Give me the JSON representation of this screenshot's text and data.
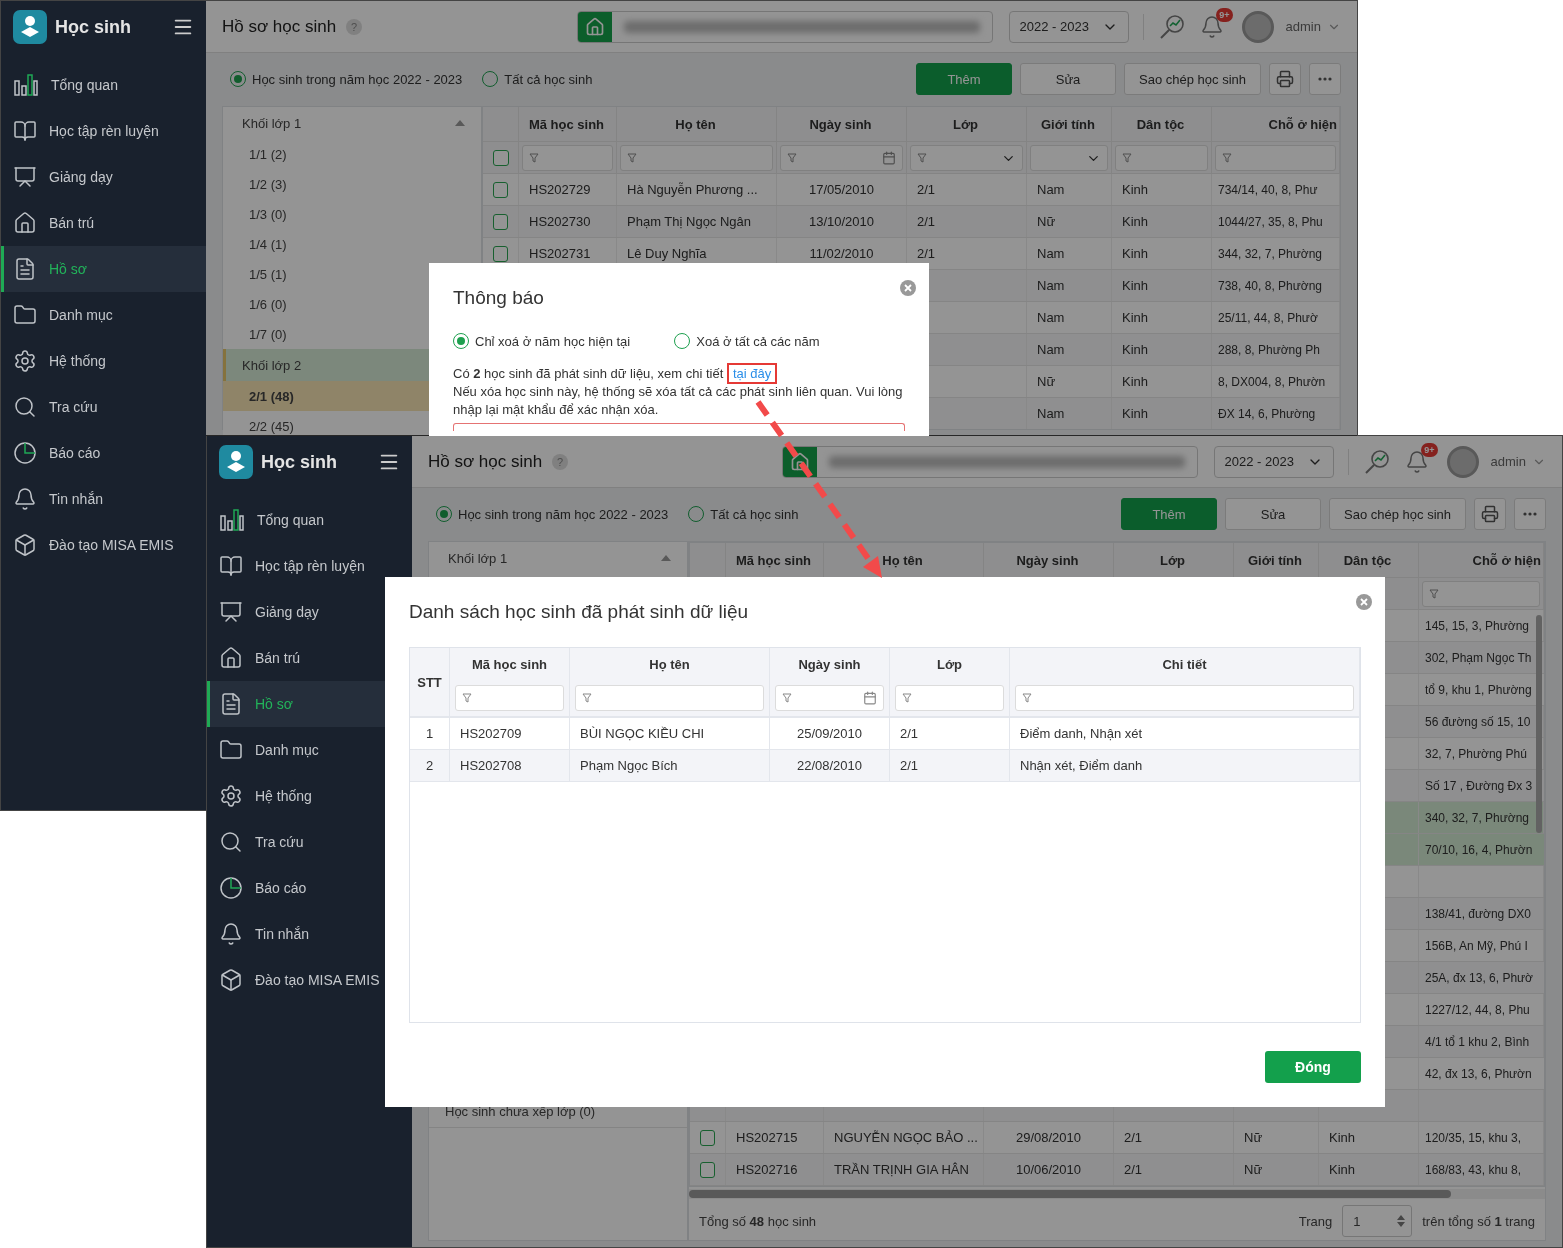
{
  "back_window": {
    "sidebar": {
      "app_title": "Học sinh",
      "items": [
        {
          "label": "Tổng quan",
          "selected": false
        },
        {
          "label": "Học tập rèn luyện",
          "selected": false
        },
        {
          "label": "Giảng dạy",
          "selected": false
        },
        {
          "label": "Bán trú",
          "selected": false
        },
        {
          "label": "Hồ sơ",
          "selected": true
        },
        {
          "label": "Danh mục",
          "selected": false
        },
        {
          "label": "Hệ thống",
          "selected": false
        },
        {
          "label": "Tra cứu",
          "selected": false
        },
        {
          "label": "Báo cáo",
          "selected": false
        },
        {
          "label": "Tin nhắn",
          "selected": false
        },
        {
          "label": "Đào tạo MISA EMIS",
          "selected": false
        }
      ]
    },
    "header": {
      "title": "Hồ sơ học sinh",
      "help": "?",
      "year": "2022 - 2023",
      "badge": "9+",
      "user": "admin"
    },
    "toolbar": {
      "filters": [
        {
          "label": "Học sinh trong năm học 2022 - 2023",
          "selected": true
        },
        {
          "label": "Tất cả học sinh",
          "selected": false
        }
      ],
      "buttons": [
        {
          "kind": "primary",
          "label": "Thêm"
        },
        {
          "kind": "secondary",
          "label": "Sửa"
        },
        {
          "kind": "secondary",
          "label": "Sao chép học sinh"
        },
        {
          "kind": "print"
        },
        {
          "kind": "more"
        }
      ]
    },
    "tree": {
      "groups": [
        {
          "label": "Khối lớp 1",
          "expanded": true,
          "selected": false,
          "children": [
            {
              "label": "1/1 (2)",
              "selected": false
            },
            {
              "label": "1/2 (3)",
              "selected": false
            },
            {
              "label": "1/3 (0)",
              "selected": false
            },
            {
              "label": "1/4 (1)",
              "selected": false
            },
            {
              "label": "1/5 (1)",
              "selected": false
            },
            {
              "label": "1/6 (0)",
              "selected": false
            },
            {
              "label": "1/7 (0)",
              "selected": false
            }
          ]
        },
        {
          "label": "Khối lớp 2",
          "selected": true,
          "children": [
            {
              "label": "2/1 (48)",
              "selected": true
            },
            {
              "label": "2/2 (45)",
              "selected": false
            }
          ]
        }
      ]
    },
    "table": {
      "header_checkbox": false,
      "columns": [
        {
          "label": "Mã học sinh",
          "kind": "text"
        },
        {
          "label": "Họ tên",
          "kind": "text"
        },
        {
          "label": "Ngày sinh",
          "kind": "date"
        },
        {
          "label": "Lớp",
          "kind": "select"
        },
        {
          "label": "Giới tính",
          "kind": "dropdown"
        },
        {
          "label": "Dân tộc",
          "kind": "text"
        },
        {
          "label": "Chỗ ở hiện",
          "kind": "text"
        }
      ],
      "rows": [
        {
          "selected": false,
          "code": "HS202729",
          "name": "Hà Nguyễn Phương ...",
          "dob": "17/05/2010",
          "class": "2/1",
          "gender": "Nam",
          "ethnicity": "Kinh",
          "address": "734/14, 40, 8, Phư"
        },
        {
          "selected": false,
          "code": "HS202730",
          "name": "Phạm Thị Ngọc Ngân",
          "dob": "13/10/2010",
          "class": "2/1",
          "gender": "Nữ",
          "ethnicity": "Kinh",
          "address": "1044/27, 35, 8, Phu"
        },
        {
          "selected": false,
          "code": "HS202731",
          "name": "Lê Duy Nghĩa",
          "dob": "11/02/2010",
          "class": "2/1",
          "gender": "Nam",
          "ethnicity": "Kinh",
          "address": "344, 32, 7, Phường"
        },
        {
          "selected": false,
          "gender": "Nam",
          "ethnicity": "Kinh",
          "address": "738, 40, 8, Phường"
        },
        {
          "selected": false,
          "gender": "Nam",
          "ethnicity": "Kinh",
          "address": "25/11, 44, 8, Phườ"
        },
        {
          "selected": false,
          "gender": "Nam",
          "ethnicity": "Kinh",
          "address": "288, 8, Phường Ph"
        },
        {
          "selected": false,
          "gender": "Nữ",
          "ethnicity": "Kinh",
          "address": "8, DX004, 8, Phườn"
        },
        {
          "selected": false,
          "gender": "Nam",
          "ethnicity": "Kinh",
          "address": "ĐX 14, 6, Phường"
        }
      ]
    },
    "modal": {
      "title": "Thông báo",
      "options": [
        {
          "label": "Chỉ xoá ở năm học hiện tại",
          "selected": true
        },
        {
          "label": "Xoá ở tất cả các năm",
          "selected": false
        }
      ],
      "message": "Có **2** học sinh đã phát sinh dữ liệu, xem chi tiết",
      "link": "tại đây",
      "warning": "Nếu xóa học sinh này, hệ thống sẽ xóa tất cả các phát sinh liên quan. Vui lòng nhập lại mật khẩu để xác nhận xóa."
    }
  },
  "front_window": {
    "sidebar": {
      "app_title": "Học sinh",
      "items": [
        {
          "label": "Tổng quan",
          "selected": false
        },
        {
          "label": "Học tập rèn luyện",
          "selected": false
        },
        {
          "label": "Giảng dạy",
          "selected": false
        },
        {
          "label": "Bán trú",
          "selected": false
        },
        {
          "label": "Hồ sơ",
          "selected": true
        },
        {
          "label": "Danh mục",
          "selected": false
        },
        {
          "label": "Hệ thống",
          "selected": false
        },
        {
          "label": "Tra cứu",
          "selected": false
        },
        {
          "label": "Báo cáo",
          "selected": false
        },
        {
          "label": "Tin nhắn",
          "selected": false
        },
        {
          "label": "Đào tạo MISA EMIS",
          "selected": false
        }
      ]
    },
    "header": {
      "title": "Hồ sơ học sinh",
      "help": "?",
      "year": "2022 - 2023",
      "badge": "9+",
      "user": "admin"
    },
    "toolbar": {
      "filters": [
        {
          "label": "Học sinh trong năm học 2022 - 2023",
          "selected": true
        },
        {
          "label": "Tất cả học sinh",
          "selected": false
        }
      ],
      "buttons": [
        {
          "kind": "primary",
          "label": "Thêm"
        },
        {
          "kind": "secondary",
          "label": "Sửa"
        },
        {
          "kind": "secondary",
          "label": "Sao chép học sinh"
        },
        {
          "kind": "print"
        },
        {
          "kind": "more"
        }
      ]
    },
    "tree": {
      "groups": [
        {
          "label": "Khối lớp 1",
          "expanded": true,
          "selected": false
        }
      ],
      "unassigned": "Học sinh chưa xếp lớp (0)"
    },
    "table": {
      "columns": [
        {
          "label": "Mã học sinh",
          "kind": "none"
        },
        {
          "label": "Họ tên",
          "kind": "none"
        },
        {
          "label": "Ngày sinh",
          "kind": "none"
        },
        {
          "label": "Lớp",
          "kind": "none"
        },
        {
          "label": "Giới tính",
          "kind": "none"
        },
        {
          "label": "Dân tộc",
          "kind": "none"
        },
        {
          "label": "Chỗ ở hiện",
          "kind": "text"
        }
      ],
      "rows": [
        {
          "selected": false,
          "address": "145, 15, 3, Phường"
        },
        {
          "selected": false,
          "address": "302, Phạm Ngọc Th"
        },
        {
          "selected": false,
          "address": "tổ 9, khu 1, Phường"
        },
        {
          "selected": false,
          "address": "56 đường số 15, 10"
        },
        {
          "selected": false,
          "address": "32, 7, Phường Phú"
        },
        {
          "selected": false,
          "address": "Số 17 , Đường Đx 3"
        },
        {
          "selected": true,
          "address": "340, 32, 7, Phường"
        },
        {
          "selected": true,
          "address": "70/10, 16, 4, Phườn"
        },
        {
          "selected": false
        },
        {
          "selected": false,
          "address": "138/41, đường DX0"
        },
        {
          "selected": false,
          "address": "156B, An Mỹ, Phú I"
        },
        {
          "selected": false,
          "address": "25A, đx 13, 6, Phườ"
        },
        {
          "selected": false,
          "address": "1227/12, 44, 8, Phu"
        },
        {
          "selected": false,
          "address": "4/1 tổ 1 khu 2, Bình"
        },
        {
          "selected": false,
          "address": "42, đx 13, 6, Phườn"
        },
        {
          "selected": false
        },
        {
          "selected": false,
          "code": "HS202715",
          "name": "NGUYỄN NGỌC BẢO ...",
          "dob": "29/08/2010",
          "class": "2/1",
          "gender": "Nữ",
          "ethnicity": "Kinh",
          "address": "120/35, 15, khu 3,"
        },
        {
          "selected": false,
          "code": "HS202716",
          "name": "TRẦN TRỊNH GIA HÂN",
          "dob": "10/06/2010",
          "class": "2/1",
          "gender": "Nữ",
          "ethnicity": "Kinh",
          "address": "168/83, 43, khu 8,"
        }
      ]
    },
    "footer": {
      "total": "Tổng số **48** học sinh",
      "page_label": "Trang",
      "page": "1",
      "page_total": "trên tổng số **1** trang"
    },
    "modal": {
      "title": "Danh sách học sinh đã phát sinh dữ liệu",
      "columns": [
        {
          "label": "STT",
          "kind": "none"
        },
        {
          "label": "Mã học sinh",
          "kind": "text"
        },
        {
          "label": "Họ tên",
          "kind": "text"
        },
        {
          "label": "Ngày sinh",
          "kind": "date"
        },
        {
          "label": "Lớp",
          "kind": "text"
        },
        {
          "label": "Chi tiết",
          "kind": "text"
        }
      ],
      "rows": [
        [
          "1",
          "HS202709",
          "BÙI NGỌC KIỀU CHI",
          "25/09/2010",
          "2/1",
          "Điểm danh, Nhận xét"
        ],
        [
          "2",
          "HS202708",
          "Phạm Ngọc Bích",
          "22/08/2010",
          "2/1",
          "Nhận xét, Điểm danh"
        ]
      ],
      "close_button": "Đóng"
    }
  }
}
